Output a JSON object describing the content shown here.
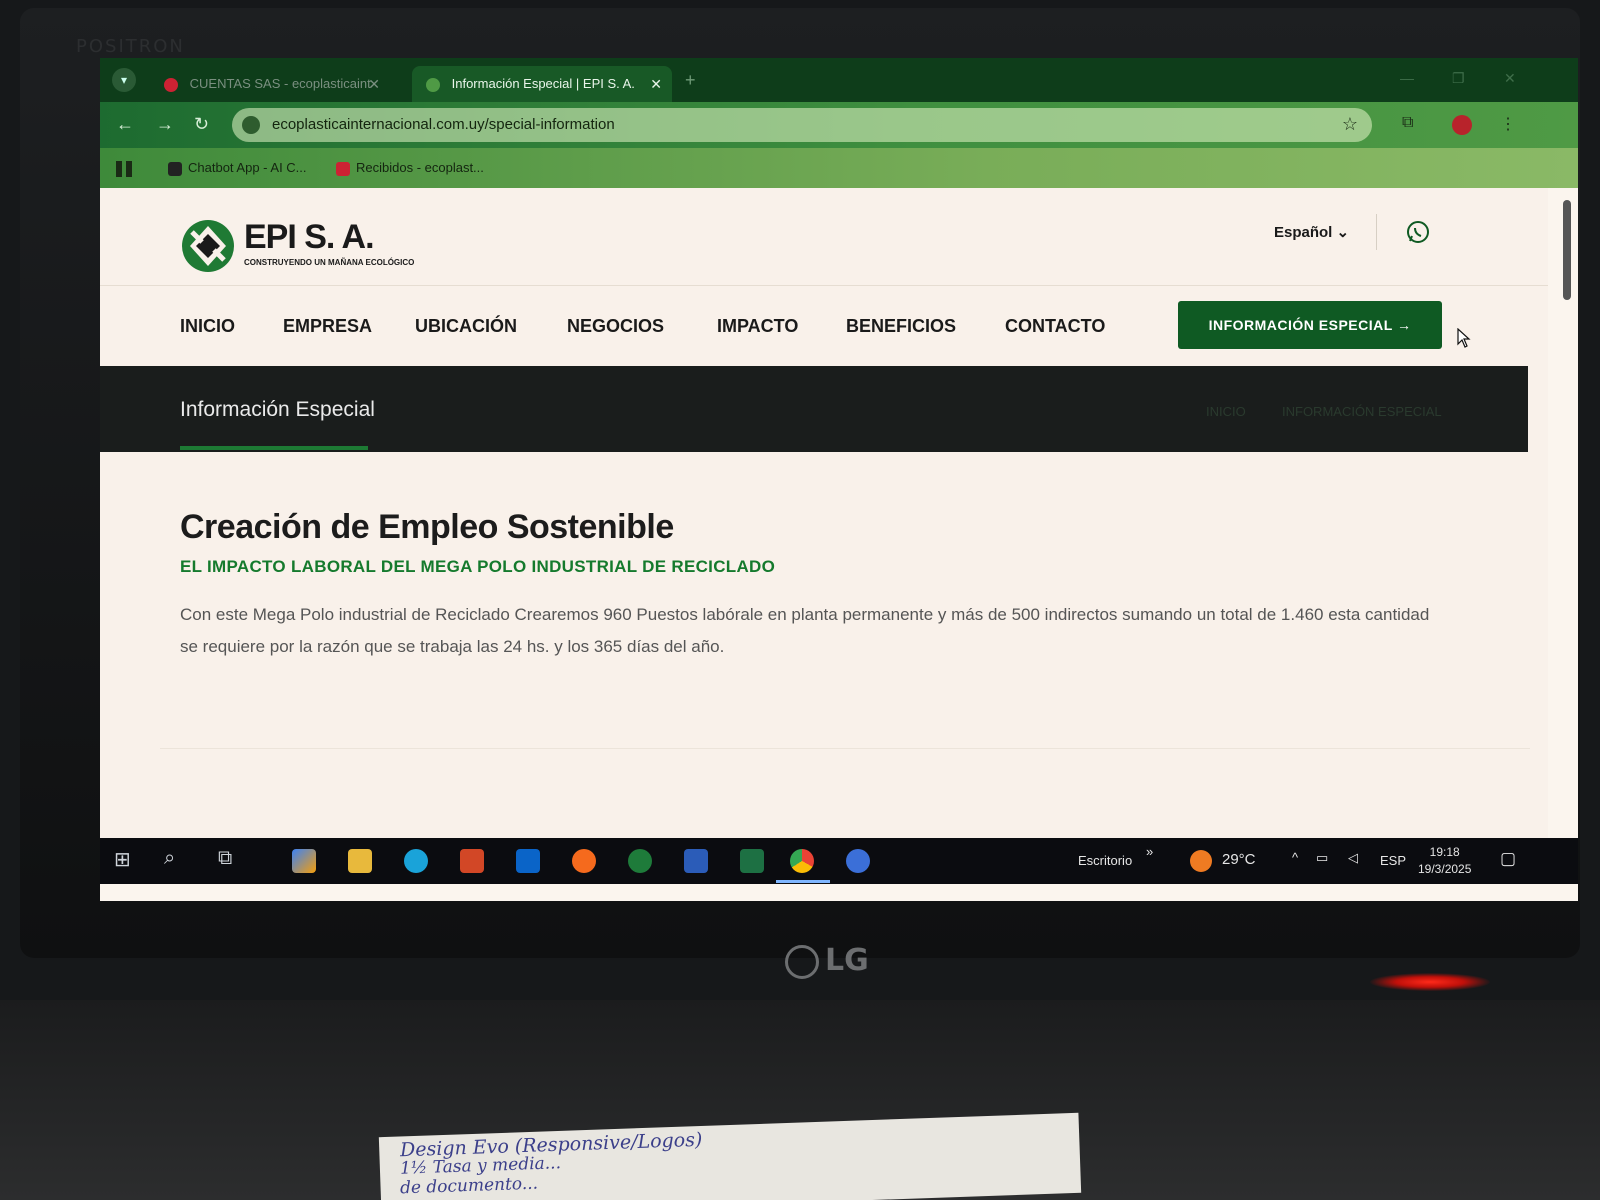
{
  "monitor": {
    "bezel_brand": "POSITRON",
    "logo": "LG"
  },
  "browser": {
    "tabs": [
      {
        "label": "CUENTAS SAS - ecoplasticaint",
        "active": false
      },
      {
        "label": "Información Especial | EPI S. A.",
        "active": true
      }
    ],
    "url": "ecoplasticainternacional.com.uy/special-information",
    "bookmarks": [
      {
        "label": "Chatbot App - AI C..."
      },
      {
        "label": "Recibidos - ecoplast..."
      }
    ]
  },
  "site": {
    "logo_name": "EPI S. A.",
    "logo_tagline": "CONSTRUYENDO UN MAÑANA ECOLÓGICO",
    "language": "Español",
    "nav": [
      "INICIO",
      "EMPRESA",
      "UBICACIÓN",
      "NEGOCIOS",
      "IMPACTO",
      "BENEFICIOS",
      "CONTACTO"
    ],
    "cta": "INFORMACIÓN ESPECIAL",
    "cta_arrow": "→",
    "banner_title": "Información Especial",
    "breadcrumb": [
      "INICIO",
      "INFORMACIÓN ESPECIAL"
    ],
    "heading": "Creación de Empleo Sostenible",
    "subheading": "EL IMPACTO LABORAL DEL MEGA POLO INDUSTRIAL DE RECICLADO",
    "paragraph": "Con este Mega Polo industrial de Reciclado Crearemos 960 Puestos labórale en planta permanente y más de 500 indirectos sumando un total de 1.460 esta cantidad se requiere por la razón que se trabaja las 24 hs. y los 365 días del año."
  },
  "taskbar": {
    "desktop_label": "Escritorio",
    "chevron": "»",
    "temperature": "29°C",
    "language": "ESP",
    "time": "19:18",
    "date": "19/3/2025"
  },
  "desk_note": {
    "line1": "Design Evo (Responsive/Logos)",
    "line2": "1½ Tasa y media...",
    "line3": "de documento..."
  },
  "colors": {
    "brand_green": "#0f5a23",
    "subheading_green": "#157a2d",
    "banner_dark": "#1a1d1c",
    "chrome_green": "#1d6b30"
  }
}
